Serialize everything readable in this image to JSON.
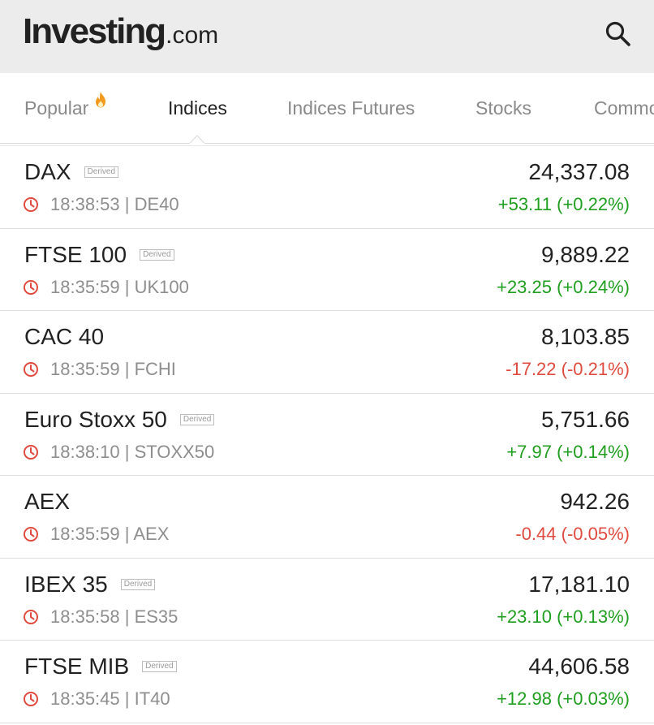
{
  "header": {
    "logo_main": "Investing",
    "logo_suffix": ".com",
    "search_icon": "search-icon"
  },
  "tabs": [
    {
      "label": "Popular",
      "active": false,
      "icon": "fire-icon"
    },
    {
      "label": "Indices",
      "active": true
    },
    {
      "label": "Indices Futures",
      "active": false
    },
    {
      "label": "Stocks",
      "active": false
    },
    {
      "label": "Commo",
      "active": false
    }
  ],
  "colors": {
    "up": "#1f9e1f",
    "down": "#e04a3f",
    "clock": "#e04a3f",
    "fire": "#f39a1e"
  },
  "instruments": [
    {
      "name": "DAX",
      "derived": "Derived",
      "time": "18:38:53",
      "symbol": "DE40",
      "meta": "18:38:53 | DE40",
      "price": "24,337.08",
      "change": "+53.11 (+0.22%)",
      "direction": "up"
    },
    {
      "name": "FTSE 100",
      "derived": "Derived",
      "time": "18:35:59",
      "symbol": "UK100",
      "meta": "18:35:59 | UK100",
      "price": "9,889.22",
      "change": "+23.25 (+0.24%)",
      "direction": "up"
    },
    {
      "name": "CAC 40",
      "derived": "",
      "time": "18:35:59",
      "symbol": "FCHI",
      "meta": "18:35:59 | FCHI",
      "price": "8,103.85",
      "change": "-17.22 (-0.21%)",
      "direction": "down"
    },
    {
      "name": "Euro Stoxx 50",
      "derived": "Derived",
      "time": "18:38:10",
      "symbol": "STOXX50",
      "meta": "18:38:10 | STOXX50",
      "price": "5,751.66",
      "change": "+7.97 (+0.14%)",
      "direction": "up"
    },
    {
      "name": "AEX",
      "derived": "",
      "time": "18:35:59",
      "symbol": "AEX",
      "meta": "18:35:59 | AEX",
      "price": "942.26",
      "change": "-0.44 (-0.05%)",
      "direction": "down"
    },
    {
      "name": "IBEX 35",
      "derived": "Derived",
      "time": "18:35:58",
      "symbol": "ES35",
      "meta": "18:35:58 | ES35",
      "price": "17,181.10",
      "change": "+23.10 (+0.13%)",
      "direction": "up"
    },
    {
      "name": "FTSE MIB",
      "derived": "Derived",
      "time": "18:35:45",
      "symbol": "IT40",
      "meta": "18:35:45 | IT40",
      "price": "44,606.58",
      "change": "+12.98 (+0.03%)",
      "direction": "up"
    }
  ]
}
